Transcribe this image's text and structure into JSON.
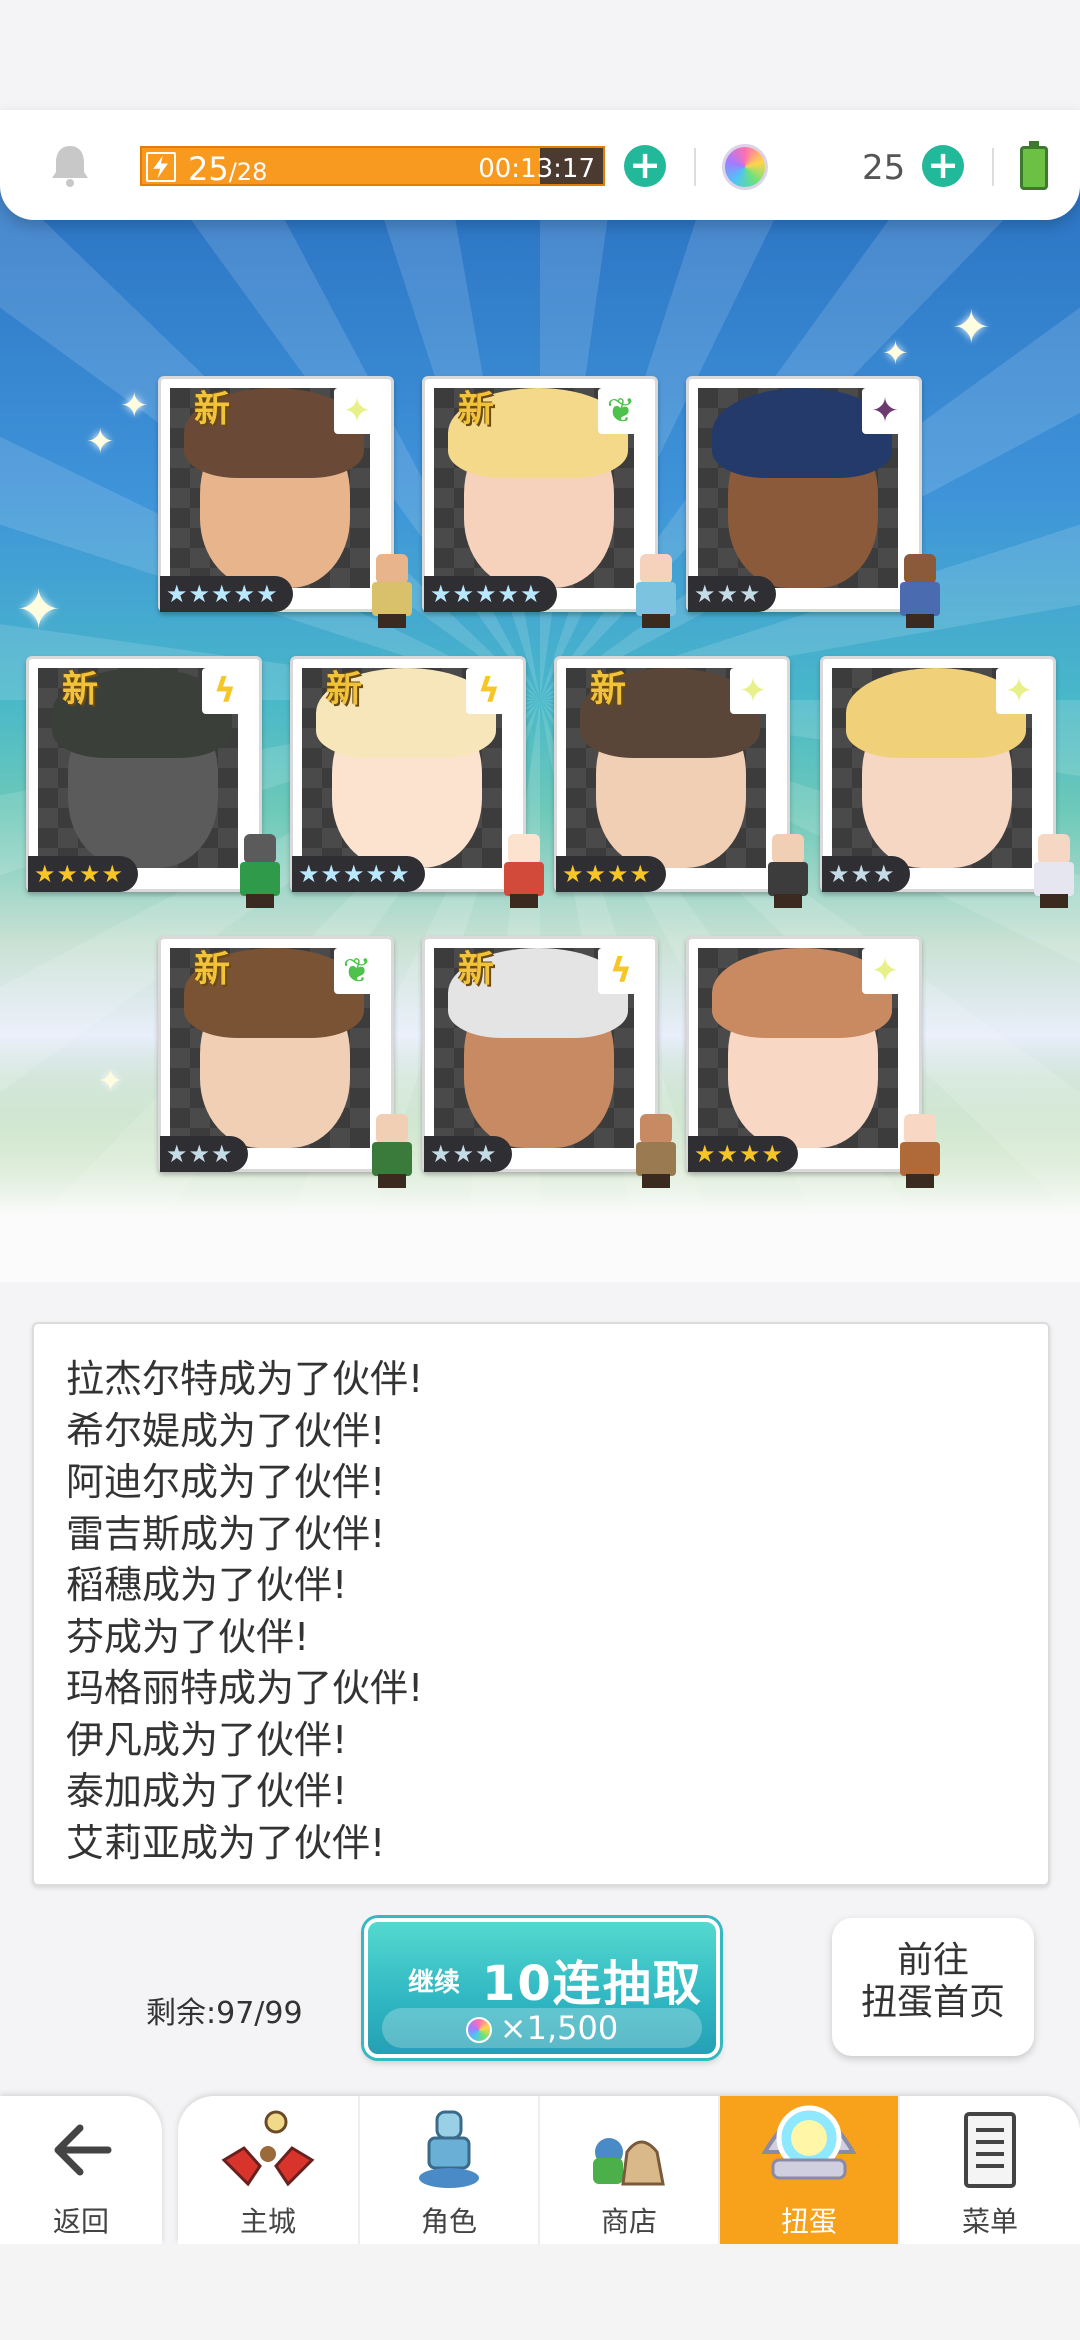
{
  "status_bar": {
    "stamina_current": "25",
    "stamina_max": "/28",
    "stamina_timer": "00:13:17",
    "gem_count": "25",
    "stamina_fill_fraction": 0.89
  },
  "cards": [
    {
      "new_label": "新",
      "element": "light",
      "element_glyph": "✦",
      "stars": "★★★★★",
      "star_style": "rainbow",
      "skin": "#e8b48c",
      "hair": "#6a4a36",
      "sprite_color": "#d9c06a"
    },
    {
      "new_label": "新",
      "element": "leaf",
      "element_glyph": "❦",
      "stars": "★★★★★",
      "star_style": "rainbow",
      "skin": "#f6d2bd",
      "hair": "#f4d98a",
      "sprite_color": "#7cc3e0"
    },
    {
      "new_label": "",
      "element": "dark",
      "element_glyph": "✦",
      "stars": "★★★",
      "star_style": "silver",
      "skin": "#8a5a3a",
      "hair": "#233a6b",
      "sprite_color": "#4a6bb0"
    },
    {
      "new_label": "新",
      "element": "thunder",
      "element_glyph": "ϟ",
      "stars": "★★★★",
      "star_style": "gold",
      "skin": "#5b5b5b",
      "hair": "#3a3f3a",
      "sprite_color": "#2e9a4a"
    },
    {
      "new_label": "新",
      "element": "thunder",
      "element_glyph": "ϟ",
      "stars": "★★★★★",
      "star_style": "rainbow",
      "skin": "#fbe3cf",
      "hair": "#f6e6b9",
      "sprite_color": "#d24a3a"
    },
    {
      "new_label": "新",
      "element": "light",
      "element_glyph": "✦",
      "stars": "★★★★",
      "star_style": "gold",
      "skin": "#f1cfb4",
      "hair": "#5a4638",
      "sprite_color": "#3c3c3c"
    },
    {
      "new_label": "",
      "element": "light",
      "element_glyph": "✦",
      "stars": "★★★",
      "star_style": "silver",
      "skin": "#f5d7c4",
      "hair": "#f1d07a",
      "sprite_color": "#e6e6f0"
    },
    {
      "new_label": "新",
      "element": "leaf",
      "element_glyph": "❦",
      "stars": "★★★",
      "star_style": "silver",
      "skin": "#f1cfb4",
      "hair": "#7a5234",
      "sprite_color": "#3a7a3a"
    },
    {
      "new_label": "新",
      "element": "thunder",
      "element_glyph": "ϟ",
      "stars": "★★★",
      "star_style": "silver",
      "skin": "#c88a62",
      "hair": "#e4e4e4",
      "sprite_color": "#9a7a50"
    },
    {
      "new_label": "",
      "element": "light",
      "element_glyph": "✦",
      "stars": "★★★★",
      "star_style": "gold",
      "skin": "#f8d8c4",
      "hair": "#c98a62",
      "sprite_color": "#b06a3a"
    }
  ],
  "messages": [
    "拉杰尔特成为了伙伴!",
    "希尔媞成为了伙伴!",
    "阿迪尔成为了伙伴!",
    "雷吉斯成为了伙伴!",
    "稻穗成为了伙伴!",
    "芬成为了伙伴!",
    "玛格丽特成为了伙伴!",
    "伊凡成为了伙伴!",
    "泰加成为了伙伴!",
    "艾莉亚成为了伙伴!"
  ],
  "actions": {
    "remaining_label": "剩余:97/99",
    "pull_continue": "继续",
    "pull_title": "10连抽取",
    "pull_cost": "×1,500",
    "home_line1": "前往",
    "home_line2": "扭蛋首页"
  },
  "nav": {
    "back_label": "返回",
    "items": [
      {
        "label": "主城",
        "icon": "castle-icon"
      },
      {
        "label": "角色",
        "icon": "character-icon"
      },
      {
        "label": "商店",
        "icon": "shop-icon"
      },
      {
        "label": "扭蛋",
        "icon": "gacha-icon",
        "active": true
      },
      {
        "label": "菜单",
        "icon": "menu-icon"
      }
    ]
  },
  "colors": {
    "accent_teal": "#22b89a",
    "stamina_orange": "#f89a20",
    "nav_active": "#f8a11a"
  }
}
